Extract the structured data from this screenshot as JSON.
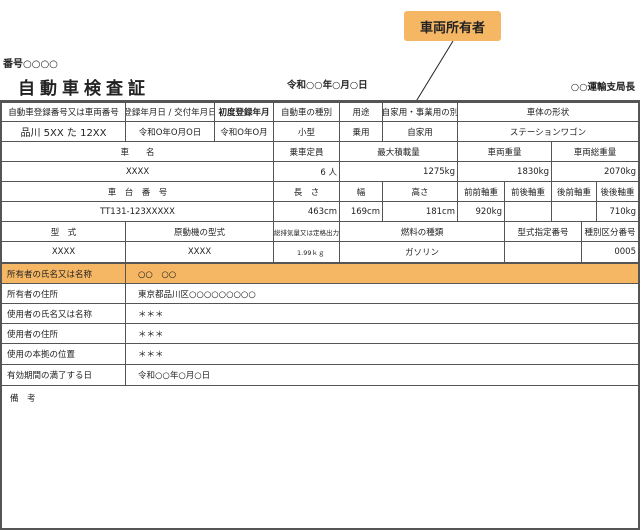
{
  "callout": {
    "label": "車両所有者",
    "color": "#f5b764"
  },
  "header": {
    "number": "番号○○○○",
    "title": "自動車検査証",
    "date": "令和○○年○月○日",
    "issuer": "○○運輸支局長"
  },
  "labels": {
    "reg_number": "自動車登録番号又は車両番号",
    "reg_date": "登録年月日 / 交付年月日",
    "first_reg": "初度登録年月",
    "vehicle_kind": "自動車の種別",
    "usage": "用途",
    "private_business": "自家用・事業用の別",
    "body_shape": "車体の形状",
    "car_name": "車　　名",
    "capacity": "乗車定員",
    "max_load": "最大積載量",
    "weight": "車両重量",
    "gross_weight": "車両総重量",
    "chassis_number": "車　台　番　号",
    "length": "長　さ",
    "width": "幅",
    "height": "高さ",
    "ff_axle": "前前軸重",
    "fr_axle": "前後軸重",
    "rf_axle": "後前軸重",
    "rr_axle": "後後軸重",
    "model": "型　式",
    "engine_model": "原動機の型式",
    "displacement": "総排気量又は定格出力",
    "fuel": "燃料の種類",
    "model_designation": "型式指定番号",
    "category_number": "種別区分番号",
    "owner_name": "所有者の氏名又は名称",
    "owner_address": "所有者の住所",
    "user_name": "使用者の氏名又は名称",
    "user_address": "使用者の住所",
    "base_location": "使用の本拠の位置",
    "expiry": "有効期間の満了する日",
    "remarks": "備　考"
  },
  "values": {
    "reg_number": "品川 5XX た 12XX",
    "reg_date": "令和O年O月O日",
    "first_reg": "令和O年O月",
    "vehicle_kind": "小型",
    "usage": "乗用",
    "private_business": "自家用",
    "body_shape": "ステーションワゴン",
    "car_name": "XXXX",
    "capacity": "6 人",
    "max_load": "1275kg",
    "weight": "1830kg",
    "gross_weight": "2070kg",
    "chassis_number": "TT131-123XXXXX",
    "length": "463cm",
    "width": "169cm",
    "height": "181cm",
    "ff_axle": "920kg",
    "fr_axle": "",
    "rf_axle": "",
    "rr_axle": "710kg",
    "model": "XXXX",
    "engine_model": "XXXX",
    "displacement": "1.99ｋｇ",
    "fuel": "ガソリン",
    "model_designation": "",
    "category_number": "0005",
    "owner_name": "○○　○○",
    "owner_address": "東京都品川区○○○○○○○○○",
    "user_name": "＊＊＊",
    "user_address": "＊＊＊",
    "base_location": "＊＊＊",
    "expiry": "令和○○年○月○日",
    "remarks": ""
  }
}
